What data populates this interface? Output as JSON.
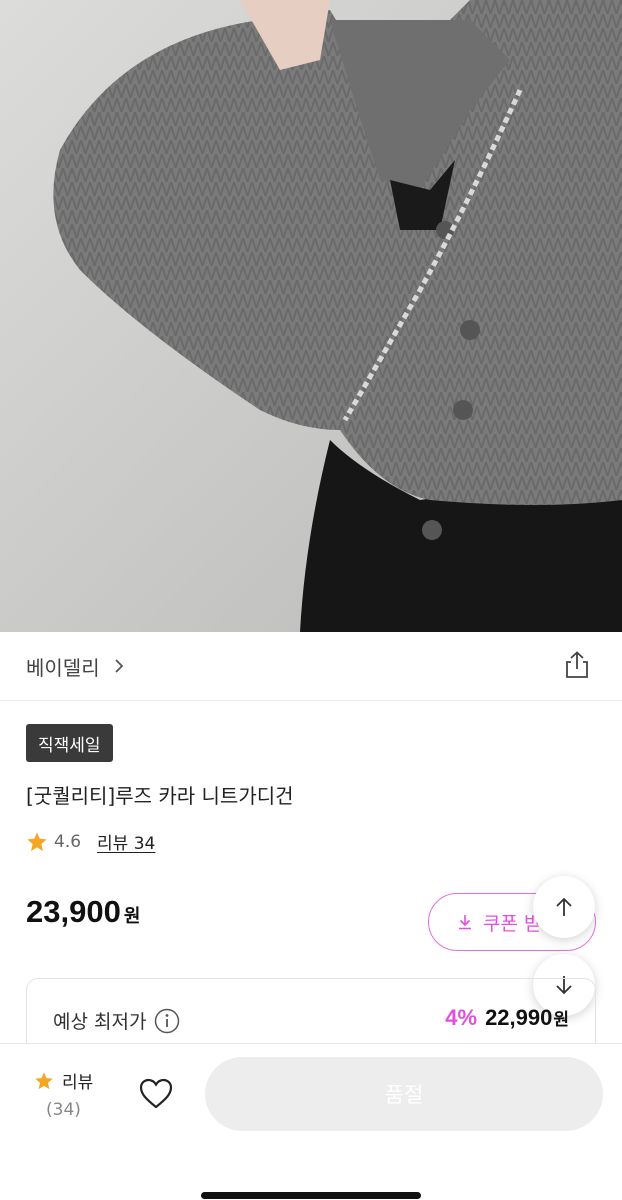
{
  "product": {
    "image_alt_icon": "product-photo",
    "brand": "베이델리",
    "badge": "직잭세일",
    "title": "[굿퀄리티]루즈 카라 니트가디건",
    "rating": "4.6",
    "review_link": "리뷰 34",
    "price": "23,900",
    "price_unit": "원",
    "coupon_label": "쿠폰 받",
    "lowest": {
      "label": "예상 최저가",
      "discount": "4%",
      "price": "22,990",
      "unit": "원"
    }
  },
  "bottom_bar": {
    "review_label": "리뷰",
    "review_count": "(34)",
    "buy_button": "품절"
  },
  "colors": {
    "accent": "#e24fdc",
    "star": "#f5a623",
    "badge_bg": "#3a3a3a",
    "button_disabled": "#ededed"
  }
}
